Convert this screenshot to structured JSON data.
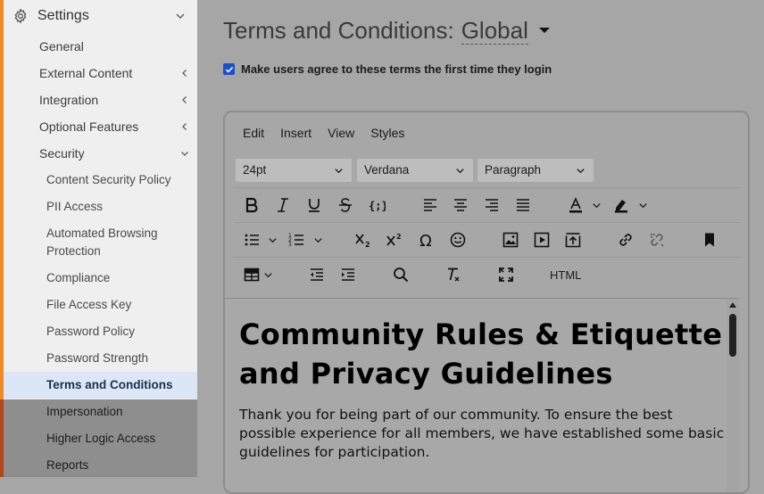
{
  "sidebar": {
    "header": "Settings",
    "items": [
      {
        "label": "General"
      },
      {
        "label": "External Content"
      },
      {
        "label": "Integration"
      },
      {
        "label": "Optional Features"
      },
      {
        "label": "Security"
      }
    ],
    "security_items": [
      {
        "label": "Content Security Policy"
      },
      {
        "label": "PII Access"
      },
      {
        "label": "Automated Browsing Protection"
      },
      {
        "label": "Compliance"
      },
      {
        "label": "File Access Key"
      },
      {
        "label": "Password Policy"
      },
      {
        "label": "Password Strength"
      },
      {
        "label": "Terms and Conditions"
      },
      {
        "label": "Impersonation"
      },
      {
        "label": "Higher Logic Access"
      },
      {
        "label": "Reports"
      }
    ],
    "accent_color": "#f08a24",
    "active_item": "Terms and Conditions"
  },
  "main": {
    "title": "Terms and Conditions:",
    "scope": "Global",
    "agree_label": "Make users agree to these terms the first time they login",
    "agree_checked": true
  },
  "editor": {
    "menu": [
      "Edit",
      "Insert",
      "View",
      "Styles"
    ],
    "font_size": "24pt",
    "font_family": "Verdana",
    "block_format": "Paragraph",
    "html_label": "HTML",
    "content": {
      "heading": "Community Rules & Etiquette and Privacy Guidelines",
      "paragraph": "Thank you for being part of our community. To ensure the best possible experience for all members, we have established some basic guidelines for participation."
    }
  }
}
